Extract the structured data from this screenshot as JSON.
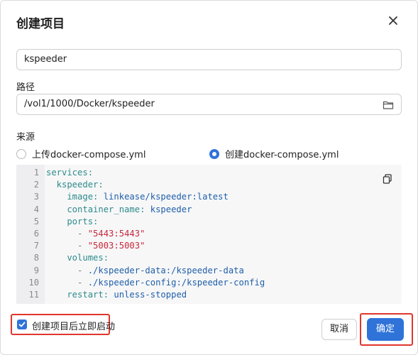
{
  "dialog": {
    "title": "创建项目",
    "close_icon": "close-icon"
  },
  "form": {
    "name_value": "kspeeder",
    "path_label": "路径",
    "path_value": "/vol1/1000/Docker/kspeeder",
    "path_icon": "folder-icon",
    "source_label": "来源",
    "source_options": [
      {
        "label": "上传docker-compose.yml",
        "selected": false
      },
      {
        "label": "创建docker-compose.yml",
        "selected": true
      }
    ]
  },
  "editor": {
    "line_numbers": [
      "1",
      "2",
      "3",
      "4",
      "5",
      "6",
      "7",
      "8",
      "9",
      "10",
      "11"
    ],
    "copy_icon": "copy-icon",
    "lines": [
      {
        "k": "services:",
        "v": ""
      },
      {
        "k": "  kspeeder:",
        "v": ""
      },
      {
        "k": "    image: ",
        "v": "linkease/kspeeder:latest"
      },
      {
        "k": "    container_name: ",
        "v": "kspeeder"
      },
      {
        "k": "    ports:",
        "v": ""
      },
      {
        "k": "      - ",
        "s": "\"5443:5443\""
      },
      {
        "k": "      - ",
        "s": "\"5003:5003\""
      },
      {
        "k": "    volumes:",
        "v": ""
      },
      {
        "k": "      - ",
        "v": "./kspeeder-data:/kspeeder-data"
      },
      {
        "k": "      - ",
        "v": "./kspeeder-config:/kspeeder-config"
      },
      {
        "k": "    restart: ",
        "v": "unless-stopped"
      }
    ]
  },
  "footer": {
    "autostart_label": "创建项目后立即启动",
    "autostart_checked": true,
    "cancel_label": "取消",
    "confirm_label": "确定"
  },
  "colors": {
    "accent": "#2f73d9",
    "highlight_border": "#e0362c"
  }
}
